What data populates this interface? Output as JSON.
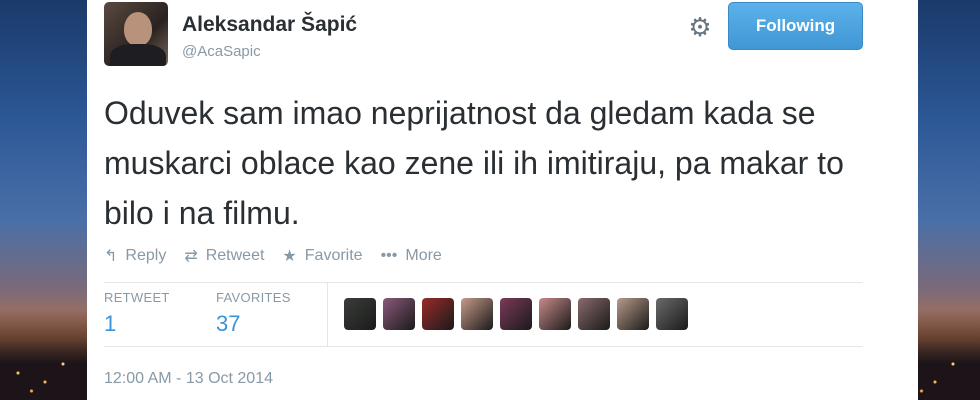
{
  "tweet": {
    "author_name": "Aleksandar Šapić",
    "author_handle": "@AcaSapic",
    "follow_label": "Following",
    "text": "Oduvek sam imao neprijatnost da gledam kada se muskarci oblace kao zene ili ih imitiraju, pa makar to bilo i na filmu.",
    "timestamp": "12:00 AM - 13 Oct 2014"
  },
  "actions": [
    {
      "name": "reply",
      "icon": "reply-icon",
      "glyph": "↰",
      "label": "Reply"
    },
    {
      "name": "retweet",
      "icon": "retweet-icon",
      "glyph": "⇄",
      "label": "Retweet"
    },
    {
      "name": "favorite",
      "icon": "star-icon",
      "glyph": "★",
      "label": "Favorite"
    },
    {
      "name": "more",
      "icon": "more-icon",
      "glyph": "•••",
      "label": "More"
    }
  ],
  "stats": {
    "retweets_label": "RETWEET",
    "retweets_value": "1",
    "favorites_label": "FAVORITES",
    "favorites_value": "37"
  },
  "favoriters": [
    {
      "color": "#3a3d3a"
    },
    {
      "color": "#8a5a7a"
    },
    {
      "color": "#9a2a2a"
    },
    {
      "color": "#c79a8a"
    },
    {
      "color": "#7a3a5a"
    },
    {
      "color": "#c88a8a"
    },
    {
      "color": "#8a6a6a"
    },
    {
      "color": "#b89a8a"
    },
    {
      "color": "#6a6a6a"
    }
  ],
  "colors": {
    "accent_blue": "#3b94d9",
    "follow_button": "#4aa3df",
    "text": "#292f33",
    "muted": "#8899a6"
  }
}
